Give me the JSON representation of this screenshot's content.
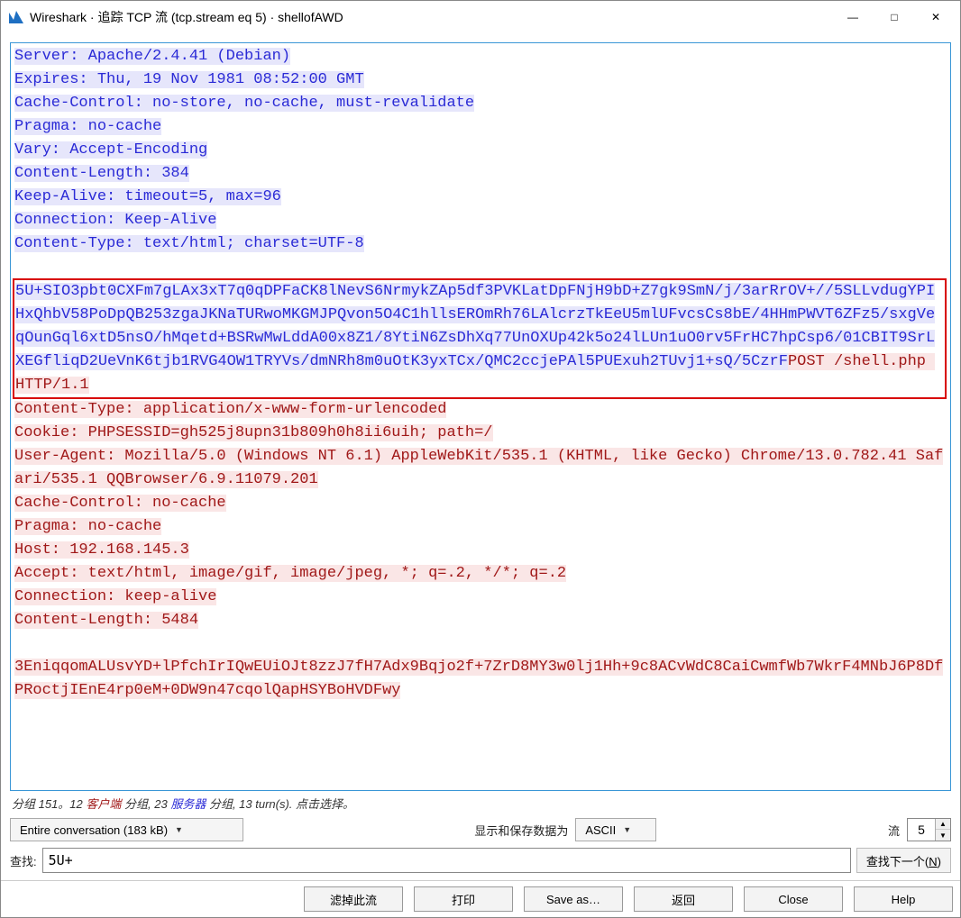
{
  "window": {
    "title": "Wireshark · 追踪 TCP 流 (tcp.stream eq 5) · shellofAWD"
  },
  "stream": {
    "block1": "Server: Apache/2.4.41 (Debian)\nExpires: Thu, 19 Nov 1981 08:52:00 GMT\nCache-Control: no-store, no-cache, must-revalidate\nPragma: no-cache\nVary: Accept-Encoding\nContent-Length: 384\nKeep-Alive: timeout=5, max=96\nConnection: Keep-Alive\nContent-Type: text/html; charset=UTF-8",
    "boxed_resp": "5U+SIO3pbt0CXFm7gLAx3xT7q0qDPFaCK8lNevS6NrmykZAp5df3PVKLatDpFNjH9bD+Z7gk9SmN/j/3arRrOV+//5SLLvdugYPIHxQhbV58PoDpQB253zgaJKNaTURwoMKGMJPQvon5O4C1hllsEROmRh76LAlcrzTkEeU5mlUFvcsCs8bE/4HHmPWVT6ZFz5/sxgVeqOunGql6xtD5nsO/hMqetd+BSRwMwLddA00x8Z1/8YtiN6ZsDhXq77UnOXUp42k5o24lLUn1uO0rv5FrHC7hpCsp6/01CBIT9SrLXEGfliqD2UeVnK6tjb1RVG4OW1TRYVs/dmNRh8m0uOtK3yxTCx/QMC2ccjePAl5PUExuh2TUvj1+sQ/5CzrF",
    "boxed_req": "POST /shell.php HTTP/1.1",
    "block3": "Content-Type: application/x-www-form-urlencoded\nCookie: PHPSESSID=gh525j8upn31b809h0h8ii6uih; path=/\nUser-Agent: Mozilla/5.0 (Windows NT 6.1) AppleWebKit/535.1 (KHTML, like Gecko) Chrome/13.0.782.41 Safari/535.1 QQBrowser/6.9.11079.201\nCache-Control: no-cache\nPragma: no-cache\nHost: 192.168.145.3\nAccept: text/html, image/gif, image/jpeg, *; q=.2, */*; q=.2\nConnection: keep-alive\nContent-Length: 5484",
    "block4": "3EniqqomALUsvYD+lPfchIrIQwEUiOJt8zzJ7fH7Adx9Bqjo2f+7ZrD8MY3w0lj1Hh+9c8ACvWdC8CaiCwmfWb7WkrF4MNbJ6P8DfPRoctjIEnE4rp0eM+0DW9n47cqolQapHSYBoHVDFwy"
  },
  "stats": {
    "pre": "分组 151。12 ",
    "client": "客户端",
    "mid1": " 分组, 23 ",
    "server": "服务器",
    "post": " 分组, 13 turn(s). 点击选择。"
  },
  "controls": {
    "conversation": "Entire conversation (183 kB)",
    "display_as_label": "显示和保存数据为",
    "format": "ASCII",
    "stream_label": "流",
    "stream_num": "5",
    "find_label": "查找:",
    "find_value": "5U+",
    "find_next": "查找下一个(N)"
  },
  "buttons": {
    "filter_out": "滤掉此流",
    "print": "打印",
    "save_as": "Save as…",
    "back": "返回",
    "close": "Close",
    "help": "Help"
  }
}
